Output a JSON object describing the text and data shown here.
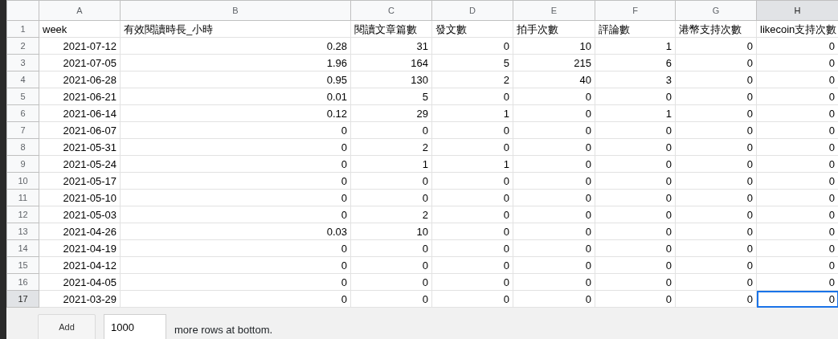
{
  "columns": [
    {
      "letter": "A",
      "selected": false
    },
    {
      "letter": "B",
      "selected": false
    },
    {
      "letter": "C",
      "selected": false
    },
    {
      "letter": "D",
      "selected": false
    },
    {
      "letter": "E",
      "selected": false
    },
    {
      "letter": "F",
      "selected": false
    },
    {
      "letter": "G",
      "selected": false
    },
    {
      "letter": "H",
      "selected": true
    }
  ],
  "rows": [
    {
      "number": "1",
      "kind": "header",
      "selected": false,
      "cells": [
        "week",
        "有效閱讀時長_小時",
        "閱讀文章篇數",
        "發文數",
        "拍手次數",
        "評論數",
        "港幣支持次數",
        "likecoin支持次數"
      ]
    },
    {
      "number": "2",
      "kind": "data",
      "selected": false,
      "cells": [
        "2021-07-12",
        "0.28",
        "31",
        "0",
        "10",
        "1",
        "0",
        "0"
      ]
    },
    {
      "number": "3",
      "kind": "data",
      "selected": false,
      "cells": [
        "2021-07-05",
        "1.96",
        "164",
        "5",
        "215",
        "6",
        "0",
        "0"
      ]
    },
    {
      "number": "4",
      "kind": "data",
      "selected": false,
      "cells": [
        "2021-06-28",
        "0.95",
        "130",
        "2",
        "40",
        "3",
        "0",
        "0"
      ]
    },
    {
      "number": "5",
      "kind": "data",
      "selected": false,
      "cells": [
        "2021-06-21",
        "0.01",
        "5",
        "0",
        "0",
        "0",
        "0",
        "0"
      ]
    },
    {
      "number": "6",
      "kind": "data",
      "selected": false,
      "cells": [
        "2021-06-14",
        "0.12",
        "29",
        "1",
        "0",
        "1",
        "0",
        "0"
      ]
    },
    {
      "number": "7",
      "kind": "data",
      "selected": false,
      "cells": [
        "2021-06-07",
        "0",
        "0",
        "0",
        "0",
        "0",
        "0",
        "0"
      ]
    },
    {
      "number": "8",
      "kind": "data",
      "selected": false,
      "cells": [
        "2021-05-31",
        "0",
        "2",
        "0",
        "0",
        "0",
        "0",
        "0"
      ]
    },
    {
      "number": "9",
      "kind": "data",
      "selected": false,
      "cells": [
        "2021-05-24",
        "0",
        "1",
        "1",
        "0",
        "0",
        "0",
        "0"
      ]
    },
    {
      "number": "10",
      "kind": "data",
      "selected": false,
      "cells": [
        "2021-05-17",
        "0",
        "0",
        "0",
        "0",
        "0",
        "0",
        "0"
      ]
    },
    {
      "number": "11",
      "kind": "data",
      "selected": false,
      "cells": [
        "2021-05-10",
        "0",
        "0",
        "0",
        "0",
        "0",
        "0",
        "0"
      ]
    },
    {
      "number": "12",
      "kind": "data",
      "selected": false,
      "cells": [
        "2021-05-03",
        "0",
        "2",
        "0",
        "0",
        "0",
        "0",
        "0"
      ]
    },
    {
      "number": "13",
      "kind": "data",
      "selected": false,
      "cells": [
        "2021-04-26",
        "0.03",
        "10",
        "0",
        "0",
        "0",
        "0",
        "0"
      ]
    },
    {
      "number": "14",
      "kind": "data",
      "selected": false,
      "cells": [
        "2021-04-19",
        "0",
        "0",
        "0",
        "0",
        "0",
        "0",
        "0"
      ]
    },
    {
      "number": "15",
      "kind": "data",
      "selected": false,
      "cells": [
        "2021-04-12",
        "0",
        "0",
        "0",
        "0",
        "0",
        "0",
        "0"
      ]
    },
    {
      "number": "16",
      "kind": "data",
      "selected": false,
      "cells": [
        "2021-04-05",
        "0",
        "0",
        "0",
        "0",
        "0",
        "0",
        "0"
      ]
    },
    {
      "number": "17",
      "kind": "data",
      "selected": true,
      "cells": [
        "2021-03-29",
        "0",
        "0",
        "0",
        "0",
        "0",
        "0",
        "0"
      ]
    }
  ],
  "footer": {
    "add_button": "Add",
    "rows_value": "1000",
    "suffix": "more rows at bottom."
  }
}
